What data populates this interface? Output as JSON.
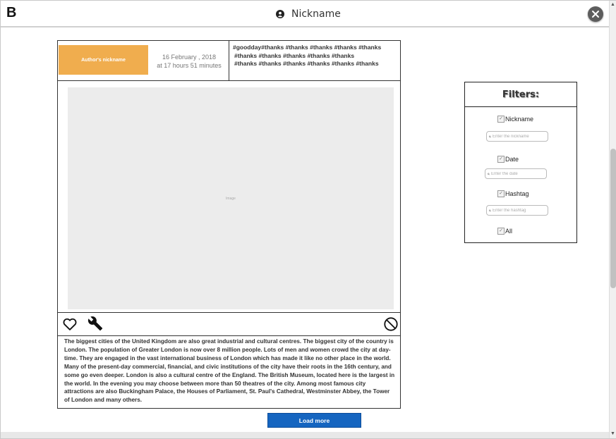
{
  "app": {
    "logo": "B",
    "username": "Nickname"
  },
  "post": {
    "author": "Author's nickname",
    "date_line1": "16 February , 2018",
    "date_line2": "at 17 hours 51 minutes",
    "hashtag_lines": [
      "#goodday#thanks  #thanks  #thanks  #thanks  #thanks",
      "#thanks  #thanks  #thanks  #thanks  #thanks",
      "#thanks  #thanks  #thanks  #thanks  #thanks  #thanks"
    ],
    "image_label": "Image",
    "text": " The biggest cities of the United Kingdom are also great industrial and cultural centres. The biggest city of the country is London. The population of Greater London is now over 8 million people. Lots of men and women crowd the city at day-time. They are engaged in the vast international business of London which has made it like no other place in the world. Many of the present-day commercial, financial, and civic institutions of the city have their roots in the 16th century, and some go even deeper. London is also a cultural centre of the England. The British Museum, located here is the largest in the world. In the evening you may choose between more than 50 theatres of the city. Among most famous city attractions are also Buckingham Palace, the Houses of Parliament, St. Paul's Cathedral, Westminster Abbey, the Tower of London and many others."
  },
  "load_more_label": "Load more",
  "filters": {
    "title": "Filters:",
    "nickname_label": "Nickname",
    "nickname_placeholder": "Enter the nickname",
    "date_label": "Date",
    "date_placeholder": "Enter the date",
    "hashtag_label": "Hashtag",
    "hashtag_placeholder": "Enter the hashtag",
    "all_label": "All",
    "check_mark": "✓"
  },
  "colors": {
    "author_bg": "#f0ad4e",
    "button_bg": "#1565c0",
    "image_bg": "#ececec"
  }
}
